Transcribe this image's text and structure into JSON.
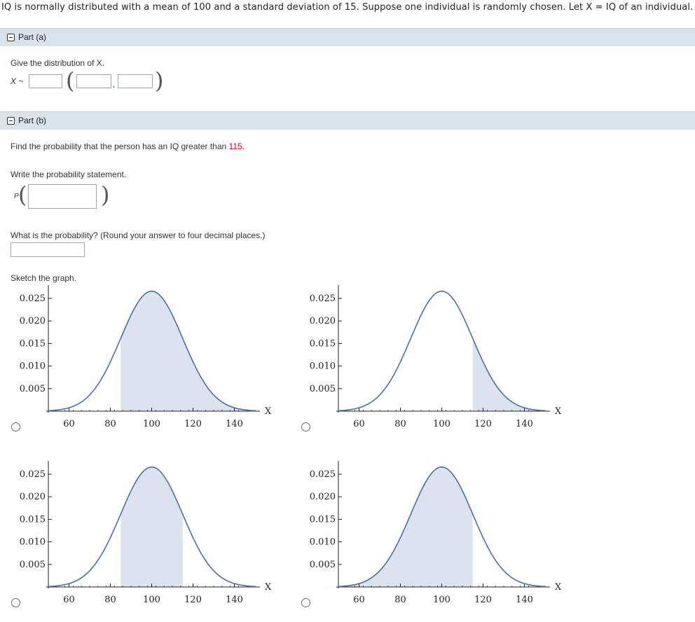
{
  "intro": "IQ is normally distributed with a mean of 100 and a standard deviation of 15. Suppose one individual is randomly chosen. Let X = IQ of an individual.",
  "part_a": {
    "label": "Part (a)",
    "prompt": "Give the distribution of X.",
    "x_label": "X ~",
    "comma": ","
  },
  "part_b": {
    "label": "Part (b)",
    "prompt_prefix": "Find the probability that the person has an IQ greater than ",
    "prompt_value": "115.",
    "statement_prompt": "Write the probability statement.",
    "p_label": "P",
    "probability_prompt": "What is the probability? (Round your answer to four decimal places.)",
    "sketch_prompt": "Sketch the graph."
  },
  "colors": {
    "curve": "#4a6fa5",
    "shade": "#dde3ee",
    "part_bar": "#d9e3ec",
    "highlight": "#c00"
  },
  "chart_data": [
    {
      "type": "area",
      "option": 1,
      "title": "",
      "xlabel": "X",
      "ylabel": "",
      "curve": {
        "distribution": "normal",
        "mean": 100,
        "sd": 15
      },
      "shaded_range": [
        85,
        160
      ],
      "xlim": [
        50,
        155
      ],
      "ylim": [
        0,
        0.028
      ],
      "xticks": [
        "60",
        "80",
        "100",
        "120",
        "140"
      ],
      "yticks": [
        "0.005",
        "0.010",
        "0.015",
        "0.020",
        "0.025"
      ]
    },
    {
      "type": "area",
      "option": 2,
      "title": "",
      "xlabel": "X",
      "ylabel": "",
      "curve": {
        "distribution": "normal",
        "mean": 100,
        "sd": 15
      },
      "shaded_range": [
        115,
        160
      ],
      "xlim": [
        50,
        155
      ],
      "ylim": [
        0,
        0.028
      ],
      "xticks": [
        "60",
        "80",
        "100",
        "120",
        "140"
      ],
      "yticks": [
        "0.005",
        "0.010",
        "0.015",
        "0.020",
        "0.025"
      ]
    },
    {
      "type": "area",
      "option": 3,
      "title": "",
      "xlabel": "X",
      "ylabel": "",
      "curve": {
        "distribution": "normal",
        "mean": 100,
        "sd": 15
      },
      "shaded_range": [
        85,
        115
      ],
      "xlim": [
        50,
        155
      ],
      "ylim": [
        0,
        0.028
      ],
      "xticks": [
        "60",
        "80",
        "100",
        "120",
        "140"
      ],
      "yticks": [
        "0.005",
        "0.010",
        "0.015",
        "0.020",
        "0.025"
      ]
    },
    {
      "type": "area",
      "option": 4,
      "title": "",
      "xlabel": "X",
      "ylabel": "",
      "curve": {
        "distribution": "normal",
        "mean": 100,
        "sd": 15
      },
      "shaded_range": [
        40,
        115
      ],
      "xlim": [
        50,
        155
      ],
      "ylim": [
        0,
        0.028
      ],
      "xticks": [
        "60",
        "80",
        "100",
        "120",
        "140"
      ],
      "yticks": [
        "0.005",
        "0.010",
        "0.015",
        "0.020",
        "0.025"
      ]
    }
  ]
}
